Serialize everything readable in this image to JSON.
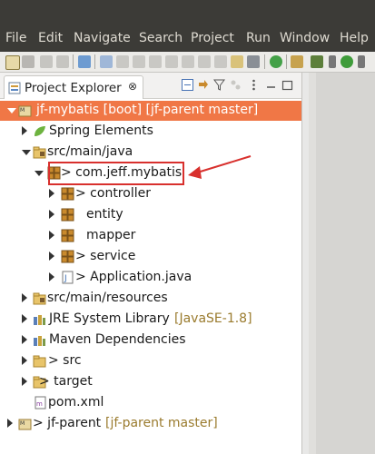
{
  "menu": [
    "File",
    "Edit",
    "Navigate",
    "Search",
    "Project",
    "Run",
    "Window",
    "Help"
  ],
  "view": {
    "title": "Project Explorer",
    "close": "⊗"
  },
  "tree": [
    {
      "label": "jf-mybatis [boot] [jf-parent master]",
      "extra": "",
      "selected": true,
      "expanded": true,
      "icon": "maven-project-icon"
    },
    {
      "label": "Spring Elements",
      "extra": "",
      "selected": false,
      "expanded": false,
      "icon": "spring-leaf-icon"
    },
    {
      "label": "src/main/java",
      "extra": "",
      "selected": false,
      "expanded": true,
      "icon": "source-folder-icon"
    },
    {
      "label": "> com.jeff.mybatis",
      "extra": "",
      "selected": false,
      "expanded": true,
      "icon": "package-icon"
    },
    {
      "label": "> controller",
      "extra": "",
      "selected": false,
      "expanded": false,
      "icon": "package-icon"
    },
    {
      "label": "entity",
      "extra": "",
      "selected": false,
      "expanded": false,
      "icon": "package-icon"
    },
    {
      "label": "mapper",
      "extra": "",
      "selected": false,
      "expanded": false,
      "icon": "package-icon"
    },
    {
      "label": "> service",
      "extra": "",
      "selected": false,
      "expanded": false,
      "icon": "package-icon"
    },
    {
      "label": "> Application.java",
      "extra": "",
      "selected": false,
      "expanded": false,
      "icon": "java-file-icon"
    },
    {
      "label": "src/main/resources",
      "extra": "",
      "selected": false,
      "expanded": false,
      "icon": "source-folder-icon"
    },
    {
      "label": "JRE System Library",
      "extra": "[JavaSE-1.8]",
      "selected": false,
      "expanded": false,
      "icon": "library-icon"
    },
    {
      "label": "Maven Dependencies",
      "extra": "",
      "selected": false,
      "expanded": false,
      "icon": "library-icon"
    },
    {
      "label": "> src",
      "extra": "",
      "selected": false,
      "expanded": false,
      "icon": "folder-icon"
    },
    {
      "label": "> target",
      "extra": "",
      "selected": false,
      "expanded": false,
      "icon": "folder-icon"
    },
    {
      "label": "pom.xml",
      "extra": "",
      "selected": false,
      "expanded": false,
      "icon": "xml-file-icon"
    },
    {
      "label": "> jf-parent",
      "extra": "[jf-parent master]",
      "selected": false,
      "expanded": false,
      "icon": "maven-project-icon"
    }
  ],
  "colors": {
    "selection": "#f07746",
    "annotation": "#d8302d",
    "menubar": "#3c3b37"
  }
}
